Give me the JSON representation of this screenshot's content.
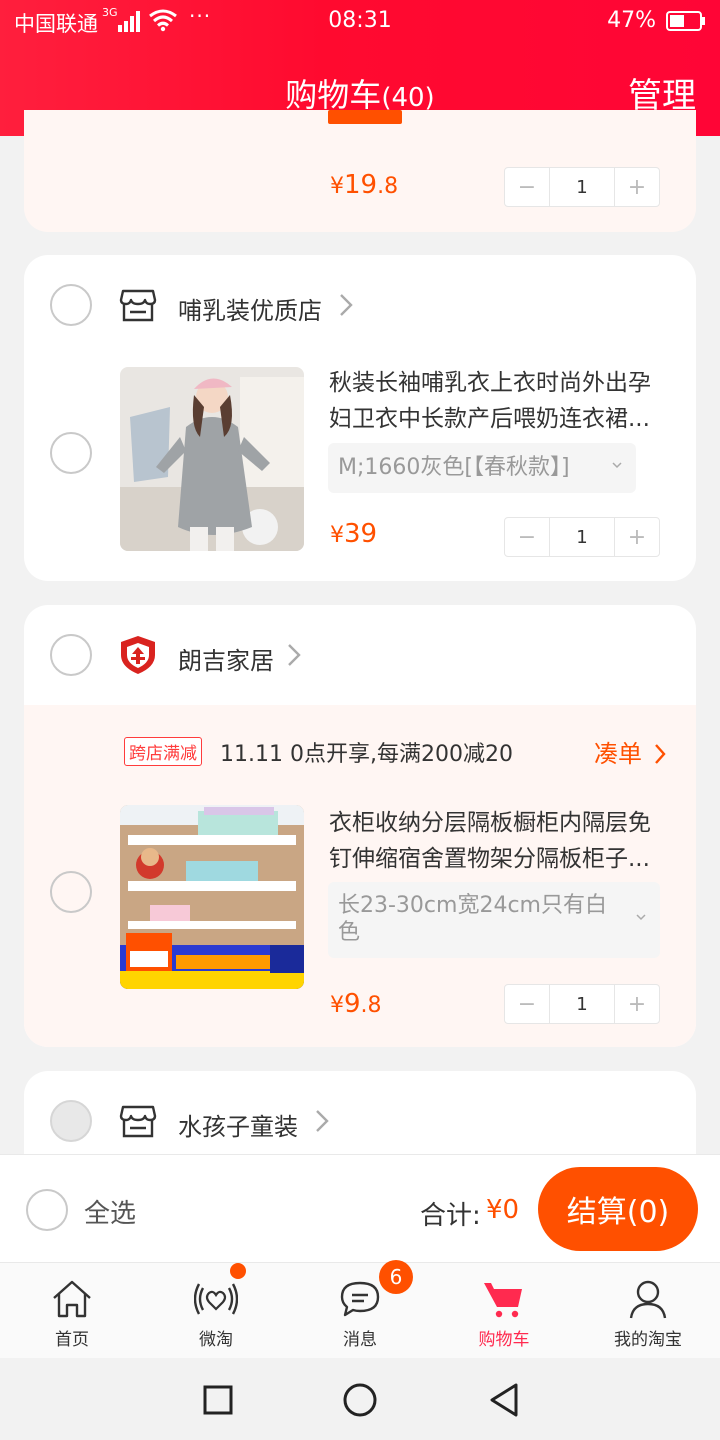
{
  "status_bar": {
    "carrier": "中国联通",
    "network": "3G",
    "dots": "···",
    "time": "08:31",
    "battery": "47%"
  },
  "header": {
    "title": "购物车",
    "count": "(40)",
    "manage": "管理"
  },
  "items": [
    {
      "price_yen": "¥",
      "price_int": "19",
      "price_dec": ".8",
      "qty_minus": "−",
      "qty": "1",
      "qty_plus": "+"
    },
    {
      "shop": "哺乳装优质店",
      "title_line1": "秋装长袖哺乳衣上衣时尚外出孕",
      "title_line2": "妇卫衣中长款产后喂奶连衣裙...",
      "sku": "M;1660灰色[【春秋款】]",
      "price_yen": "¥",
      "price_int": "39",
      "price_dec": "",
      "qty_minus": "−",
      "qty": "1",
      "qty_plus": "+"
    },
    {
      "shop": "朗吉家居",
      "promo_tag": "跨店满减",
      "promo_text": "11.11 0点开享,每满200减20",
      "promo_link": "凑单",
      "title_line1": "衣柜收纳分层隔板橱柜内隔层免",
      "title_line2": "钉伸缩宿舍置物架分隔板柜子...",
      "sku_line1": "长23-30cm宽24cm只有白",
      "sku_line2": "色",
      "price_yen": "¥",
      "price_int": "9",
      "price_dec": ".8",
      "qty_minus": "−",
      "qty": "1",
      "qty_plus": "+"
    },
    {
      "shop": "水孩子童装"
    }
  ],
  "checkout": {
    "select_all": "全选",
    "total_label": "合计:",
    "total_value": "¥0",
    "button": "结算(0)"
  },
  "tabs": [
    {
      "label": "首页",
      "icon": "home-icon"
    },
    {
      "label": "微淘",
      "icon": "heart-signal-icon"
    },
    {
      "label": "消息",
      "icon": "message-icon"
    },
    {
      "label": "购物车",
      "icon": "cart-icon"
    },
    {
      "label": "我的淘宝",
      "icon": "user-icon"
    }
  ],
  "badges": {
    "messages": "6"
  },
  "colors": {
    "header_red": "#ff0a2f",
    "accent_orange": "#ff5000",
    "active_tab": "#ff2a4f"
  }
}
